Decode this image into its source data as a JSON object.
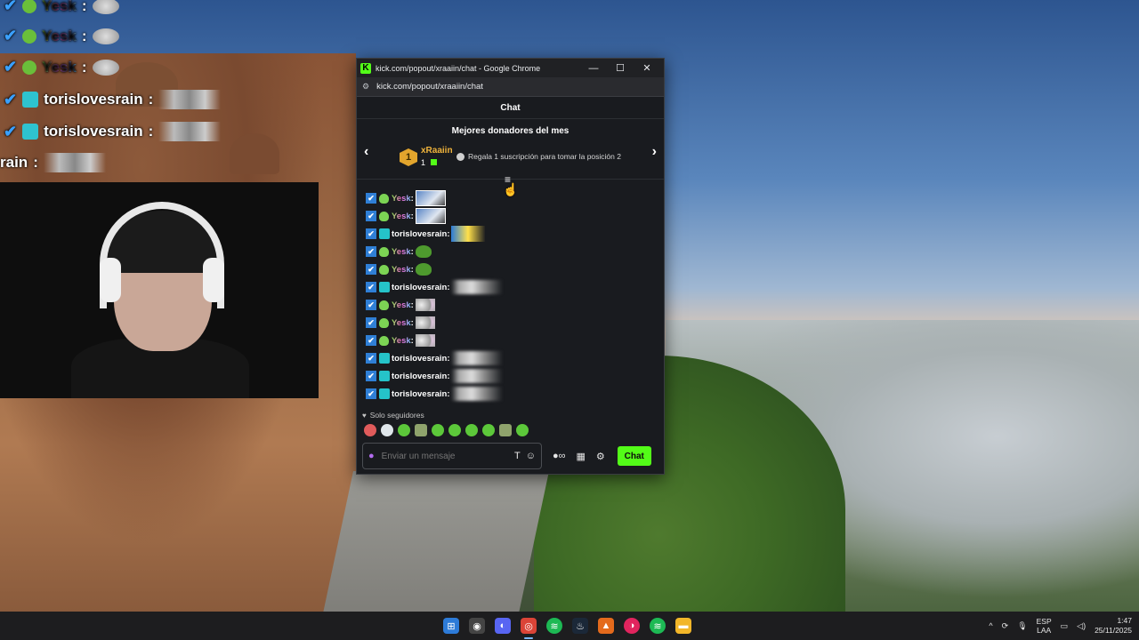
{
  "overlay": {
    "lines": [
      {
        "name": "Yesk",
        "sep": ":"
      },
      {
        "name": "Yesk",
        "sep": ":"
      },
      {
        "name": "Yesk",
        "sep": ":"
      },
      {
        "name": "torislovesrain",
        "sep": ":"
      },
      {
        "name": "torislovesrain",
        "sep": ":"
      },
      {
        "name": "rain",
        "sep": ":"
      }
    ]
  },
  "window": {
    "title": "kick.com/popout/xraaiin/chat - Google Chrome",
    "url": "kick.com/popout/xraaiin/chat",
    "minimize": "—",
    "maximize": "☐",
    "close": "✕"
  },
  "chat": {
    "header": "Chat",
    "donors_title": "Mejores donadores del mes",
    "top_donor": {
      "rank": "1",
      "name": "xRaaiin",
      "count": "1"
    },
    "gift_note": "Regala 1 suscripción para tomar la posición 2",
    "messages": [
      {
        "user": "Yesk",
        "emote": "photo"
      },
      {
        "user": "Yesk",
        "emote": "photo"
      },
      {
        "user": "torislovesrain",
        "emote": "car"
      },
      {
        "user": "Yesk",
        "emote": "frog"
      },
      {
        "user": "Yesk",
        "emote": "frog"
      },
      {
        "user": "torislovesrain",
        "emote": "blur"
      },
      {
        "user": "Yesk",
        "emote": "cat"
      },
      {
        "user": "Yesk",
        "emote": "cat"
      },
      {
        "user": "Yesk",
        "emote": "cat"
      },
      {
        "user": "torislovesrain",
        "emote": "blur"
      },
      {
        "user": "torislovesrain",
        "emote": "blur"
      },
      {
        "user": "torislovesrain",
        "emote": "blur"
      }
    ],
    "followers_only": "Solo seguidores",
    "input_placeholder": "Enviar un mensaje",
    "send_label": "Chat"
  },
  "taskbar": {
    "lang_top": "ESP",
    "lang_bottom": "LAA",
    "time": "1:47",
    "date": "25/11/2025"
  },
  "colors": {
    "kick_green": "#53fc18",
    "donor_gold": "#f0b43c"
  }
}
